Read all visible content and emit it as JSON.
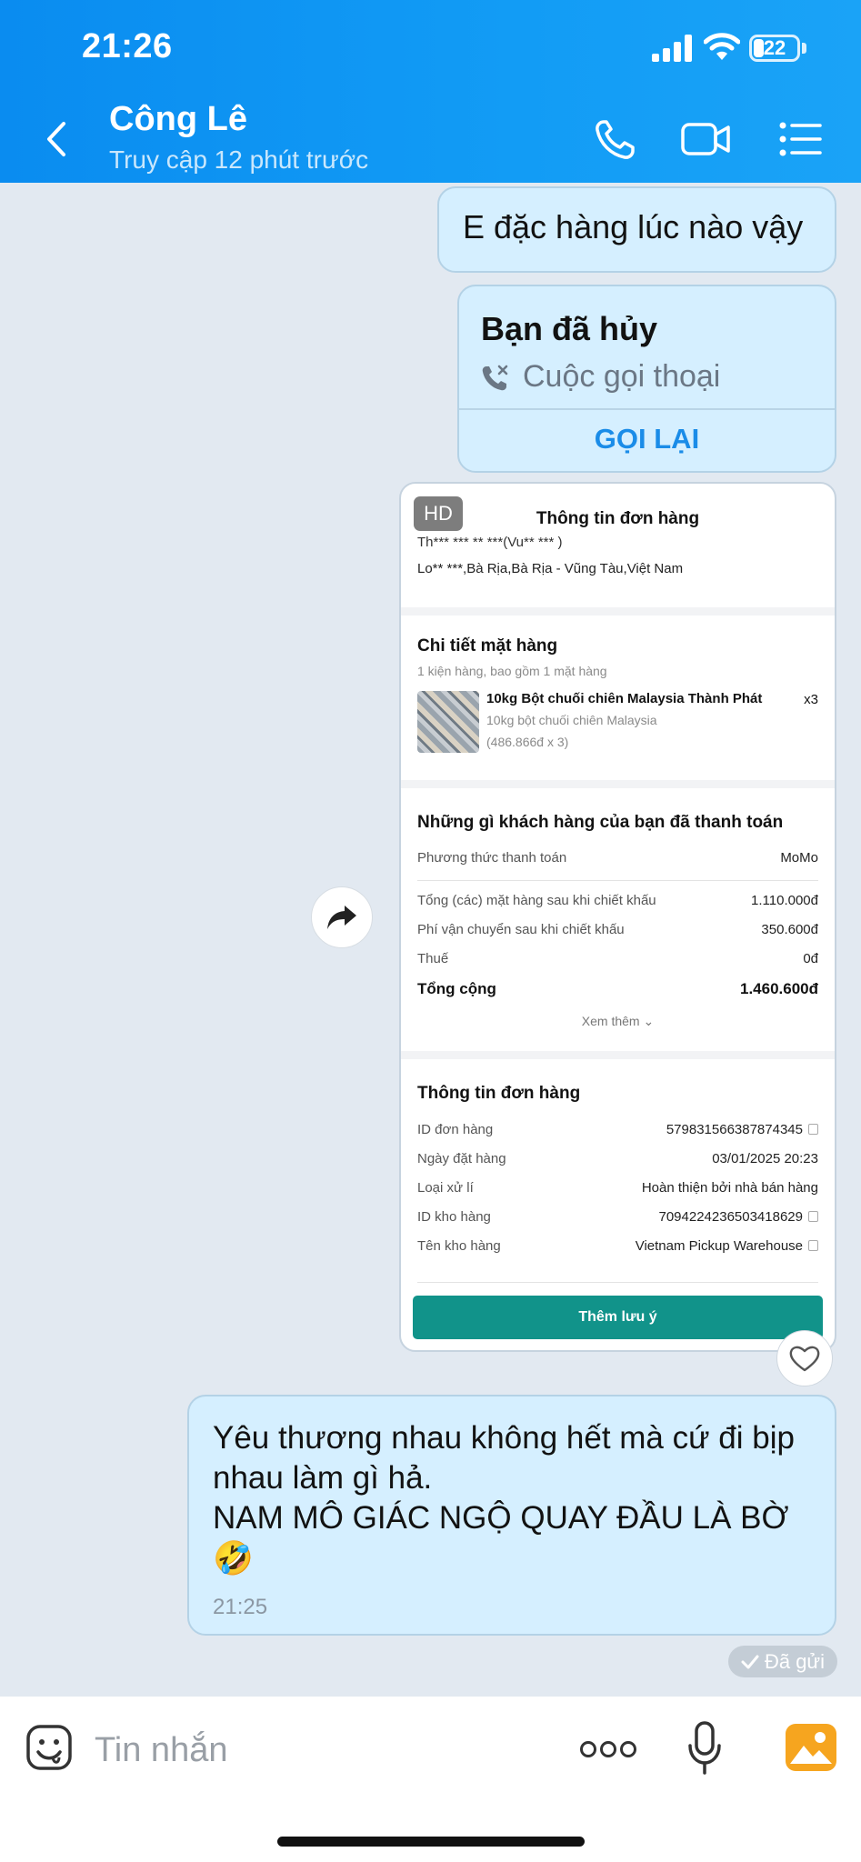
{
  "status_bar": {
    "time": "21:26",
    "battery": "22"
  },
  "header": {
    "contact_name": "Công Lê",
    "contact_status": "Truy cập 12 phút trước",
    "icons": [
      "back-icon",
      "phone-icon",
      "video-icon",
      "menu-icon"
    ]
  },
  "messages": {
    "m1": {
      "text": "E đặc hàng lúc nào vậy"
    },
    "m2": {
      "title": "Bạn đã hủy",
      "call_type": "Cuộc gọi thoại",
      "recall_label": "GỌI LẠI"
    },
    "order_card": {
      "hd_badge": "HD",
      "title": "Thông tin đơn hàng",
      "address_line1": "Th*** *** ** ***(Vu** *** )",
      "address_line2": "Lo** ***,Bà Rịa,Bà Rịa - Vũng Tàu,Việt Nam",
      "items_section": {
        "title": "Chi tiết mặt hàng",
        "subtitle": "1 kiện hàng, bao gồm 1 mặt hàng",
        "item_name": "10kg Bột chuối chiên Malaysia Thành Phát",
        "item_qty": "x3",
        "item_variant": "10kg bột chuối chiên Malaysia",
        "item_price": "(486.866đ x 3)"
      },
      "payment_section": {
        "title": "Những gì khách hàng của bạn đã thanh toán",
        "method_label": "Phương thức thanh toán",
        "method_value": "MoMo",
        "rows": [
          {
            "label": "Tổng (các) mặt hàng sau khi chiết khấu",
            "value": "1.110.000đ"
          },
          {
            "label": "Phí vận chuyển sau khi chiết khấu",
            "value": "350.600đ"
          },
          {
            "label": "Thuế",
            "value": "0đ"
          }
        ],
        "total_label": "Tổng cộng",
        "total_value": "1.460.600đ",
        "see_more": "Xem thêm"
      },
      "order_info": {
        "title": "Thông tin đơn hàng",
        "rows": [
          {
            "label": "ID đơn hàng",
            "value": "579831566387874345"
          },
          {
            "label": "Ngày đặt hàng",
            "value": "03/01/2025 20:23"
          },
          {
            "label": "Loại xử lí",
            "value": "Hoàn thiện bởi nhà bán hàng"
          },
          {
            "label": "ID kho hàng",
            "value": "7094224236503418629"
          },
          {
            "label": "Tên kho hàng",
            "value": "Vietnam Pickup Warehouse"
          }
        ]
      },
      "add_note_label": "Thêm lưu ý"
    },
    "m3": {
      "text": "Yêu thương nhau không hết mà cứ đi bịp nhau làm gì hả.\nNAM MÔ GIÁC NGỘ QUAY ĐẦU LÀ BỜ",
      "emoji": "🤣",
      "time": "21:25"
    },
    "sent_status": "Đã gửi"
  },
  "composer": {
    "placeholder": "Tin nhắn"
  },
  "colors": {
    "header": "#0a8cf0",
    "bubble": "#d5efff",
    "accent": "#1a8ce8",
    "note_button": "#11938a"
  }
}
